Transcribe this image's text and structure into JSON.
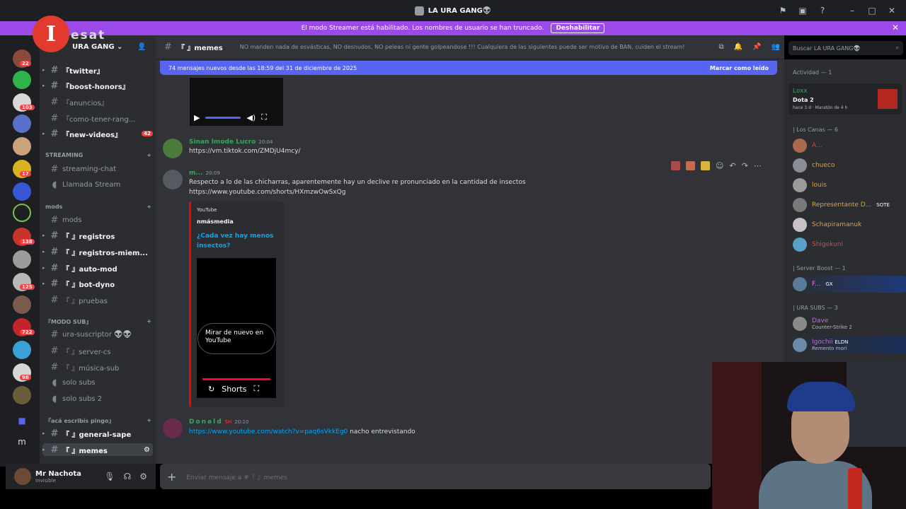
{
  "titlebar": {
    "title": "LA URA GANG👽"
  },
  "banner": {
    "text": "El modo Streamer está habilitado. Los nombres de usuario se han truncado.",
    "button": "Deshabilitar"
  },
  "overlay": {
    "logo_letter": "I",
    "logo_text": "esat"
  },
  "server": {
    "name": "URA GANG"
  },
  "server_badges": [
    "22",
    "103",
    "17",
    "138",
    "125",
    "722",
    "98"
  ],
  "channels": [
    {
      "name": "『twitter』"
    },
    {
      "name": "『boost-honors』"
    },
    {
      "name": "『anuncios』"
    },
    {
      "name": "『como-tener-rang..."
    },
    {
      "name": "『new-videos』",
      "badge": "42"
    },
    {
      "name": "streaming-chat"
    },
    {
      "name": "Llamada Stream"
    },
    {
      "name": "mods"
    },
    {
      "name": "『 』registros"
    },
    {
      "name": "『 』registros-miem..."
    },
    {
      "name": "『 』auto-mod"
    },
    {
      "name": "『 』bot-dyno"
    },
    {
      "name": "『 』pruebas"
    },
    {
      "name": "ura-suscriptor 👽👽"
    },
    {
      "name": "『 』server-cs"
    },
    {
      "name": "『 』música-sub"
    },
    {
      "name": "solo subs"
    },
    {
      "name": "solo subs 2"
    },
    {
      "name": "『 』general-sape"
    },
    {
      "name": "『 』memes"
    }
  ],
  "categories": {
    "streaming": "STREAMING",
    "mods": "mods",
    "modo_sub": "『MODO SUB』",
    "aca": "『acá escribís pingo』"
  },
  "user": {
    "name": "Mr Nachota",
    "status": "Invisible"
  },
  "chathead": {
    "channel": "『 』memes",
    "topic": "NO manden nada de esvásticas, NO desnudos, NO peleas ni gente golpeandose !!! Cualquiera de las siguientes puede ser motivo de BAN, cuiden el stream!"
  },
  "search": {
    "placeholder": "Buscar LA URA GANG👽"
  },
  "newbar": {
    "text": "74 mensajes nuevos desde las 18:59 del 31 de diciembre de 2025",
    "action": "Marcar como leído"
  },
  "messages": [
    {
      "author": "Sinan Imode Lucro",
      "time": "20:04",
      "link": "https://vm.tiktok.com/ZMDjU4mcy/"
    },
    {
      "author": "m...",
      "time": "20:09",
      "text": "Respecto a lo de las chicharras, aparentemente hay un declive re pronunciado en la cantidad de insectos",
      "link": "https://www.youtube.com/shorts/HXmzwOwSxQg"
    },
    {
      "author": "Donald",
      "tag": "SH",
      "time": "20:10",
      "link": "https://www.youtube.com/watch?v=paq6sVkkEg0",
      "text": "nacho entrevistando"
    }
  ],
  "embed": {
    "provider": "YouTube",
    "author": "nmásmedia",
    "title": "¿Cada vez hay menos insectos?",
    "watch": "Mirar de nuevo en YouTube",
    "shorts": "Shorts"
  },
  "input": {
    "placeholder": "Enviar mensaje a #『 』memes"
  },
  "members": {
    "activity": "Actividad — 1",
    "activity_user": {
      "name": "Loxx",
      "game": "Dota 2",
      "detail": "hace 3 d · Maratón de 4 h"
    },
    "group1": "| Los Canas — 6",
    "group1_users": [
      "A...",
      "chueco",
      "louis",
      "Representante D...",
      "Schapiramanuk",
      "Shigekuni"
    ],
    "sote": "SOTE",
    "group2": "| Server Boost — 1",
    "group2_user": "F...",
    "gx": "GX",
    "group3": "| URA SUBS — 3",
    "group3_users": [
      {
        "name": "Dave",
        "sub": "Counter-Strike 2"
      },
      {
        "name": "Igochii",
        "tag": "ELDN",
        "sub": "Remento mori"
      }
    ]
  },
  "colors": {
    "accent": "#5865f2",
    "banner": "#9b49e8",
    "link": "#00a8fc",
    "green": "#3ba55d",
    "red": "#f23f43"
  }
}
